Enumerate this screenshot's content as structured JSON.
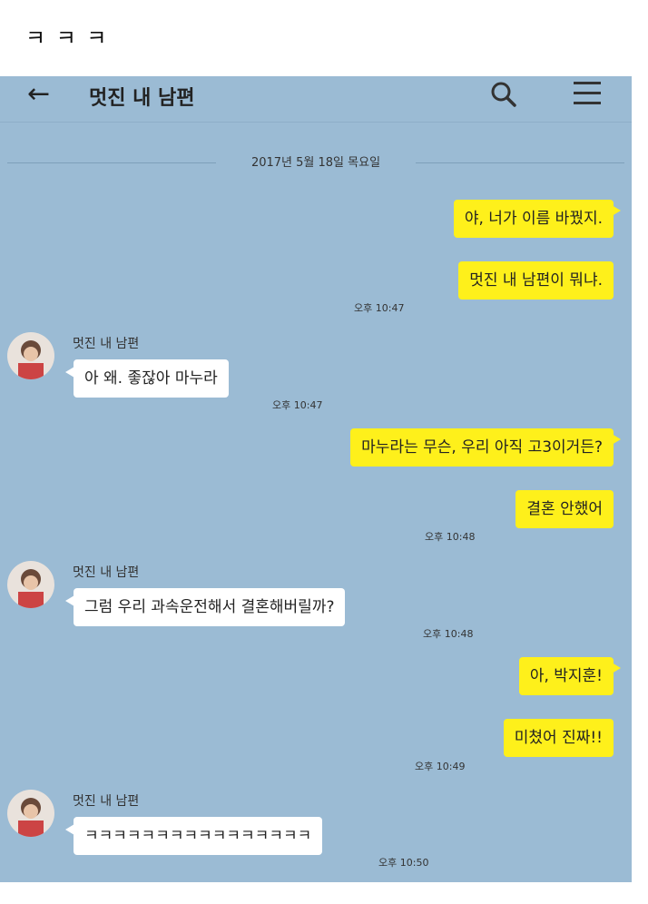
{
  "caption": "ㅋ ㅋ ㅋ",
  "header": {
    "back_icon": "arrow-left-icon",
    "title": "멋진 내 남편",
    "search_icon": "search-icon",
    "menu_icon": "hamburger-menu-icon"
  },
  "date_divider": "2017년 5월 18일 목요일",
  "messages": [
    {
      "from": "me",
      "text": "야, 너가 이름 바꿨지."
    },
    {
      "from": "me",
      "text": "멋진 내 남편이 뭐냐.",
      "time": "오후 10:47"
    },
    {
      "from": "friend",
      "sender": "멋진 내 남편",
      "text": "아 왜. 좋잖아 마누라",
      "time": "오후 10:47"
    },
    {
      "from": "me",
      "text": "마누라는 무슨, 우리 아직 고3이거든?"
    },
    {
      "from": "me",
      "text": "결혼 안했어",
      "time": "오후 10:48"
    },
    {
      "from": "friend",
      "sender": "멋진 내 남편",
      "text": "그럼 우리 과속운전해서 결혼해버릴까?",
      "time": "오후 10:48"
    },
    {
      "from": "me",
      "text": "아, 박지훈!"
    },
    {
      "from": "me",
      "text": "미쳤어 진짜!!",
      "time": "오후 10:49"
    },
    {
      "from": "friend",
      "sender": "멋진 내 남편",
      "text": "ㅋㅋㅋㅋㅋㅋㅋㅋㅋㅋㅋㅋㅋㅋㅋㅋ",
      "time": "오후 10:50"
    }
  ],
  "colors": {
    "chat_background": "#9bbbd4",
    "my_bubble": "#fef01b",
    "friend_bubble": "#ffffff"
  }
}
